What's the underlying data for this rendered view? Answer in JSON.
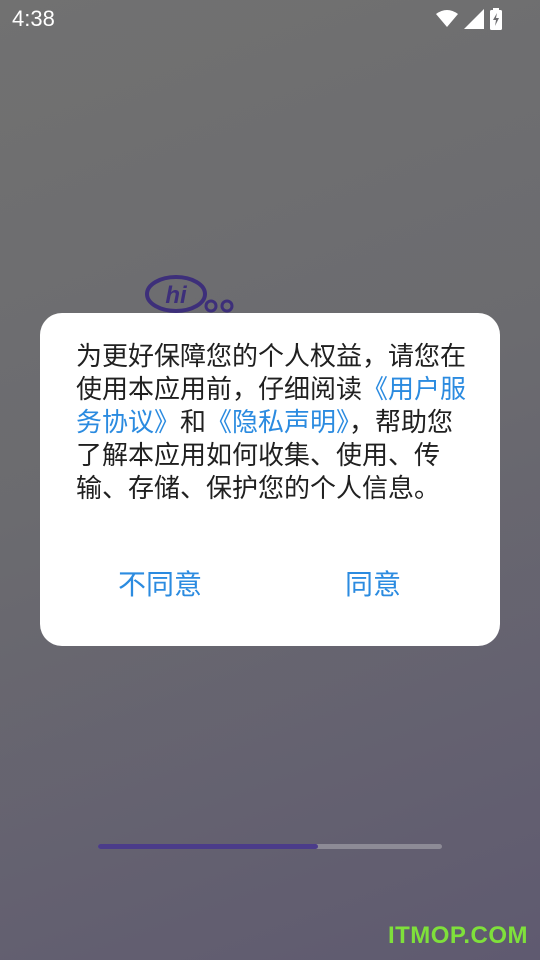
{
  "status_bar": {
    "time": "4:38",
    "icons": [
      "wifi-icon",
      "signal-icon",
      "battery-charging-icon"
    ]
  },
  "logo": {
    "text": "hi"
  },
  "dialog": {
    "message_parts": [
      "为更好保障您的个人权益，请您在使用本应用前，仔细阅读",
      "《用户服务协议》",
      "和",
      "《隐私声明》",
      "，帮助您了解本应用如何收集、使用、传输、存储、保护您的个人信息。"
    ],
    "disagree_label": "不同意",
    "agree_label": "同意"
  },
  "loading_progress": 0.64,
  "watermark": "ITMOP.COM",
  "colors": {
    "link": "#2b8be0",
    "progress": "#4b3c8a",
    "watermark": "#7fe03b"
  }
}
